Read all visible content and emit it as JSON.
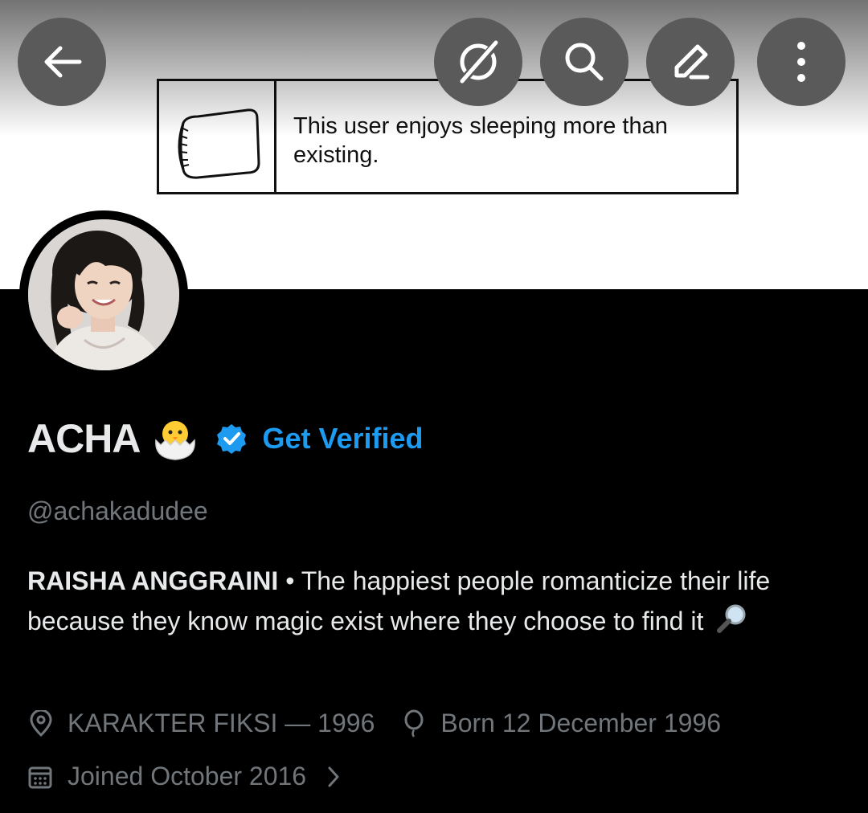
{
  "banner": {
    "userbox_text": "This user enjoys sleeping more than existing."
  },
  "nav": {
    "back": "back-arrow-icon",
    "grok": "grok-icon",
    "search": "search-icon",
    "edit": "edit-icon",
    "more": "more-vertical-icon"
  },
  "profile": {
    "display_name": "ACHA",
    "name_emoji": "hatching-chick-emoji",
    "get_verified_label": "Get Verified",
    "handle": "@achakadudee",
    "bio_name": "RAISHA ANGGRAINI",
    "bio_separator": " • ",
    "bio_text": "The happiest people romanticize their life because they know magic exist where they choose to find it",
    "bio_emoji": "magnifying-glass-emoji",
    "location": "KARAKTER FIKSI — 1996",
    "birthday": "Born 12 December 1996",
    "joined": "Joined October 2016"
  },
  "colors": {
    "background": "#000000",
    "text_primary": "#e7e9ea",
    "text_secondary": "#71767b",
    "accent_blue": "#1d9bf0",
    "button_gray": "#5a5a5a"
  }
}
